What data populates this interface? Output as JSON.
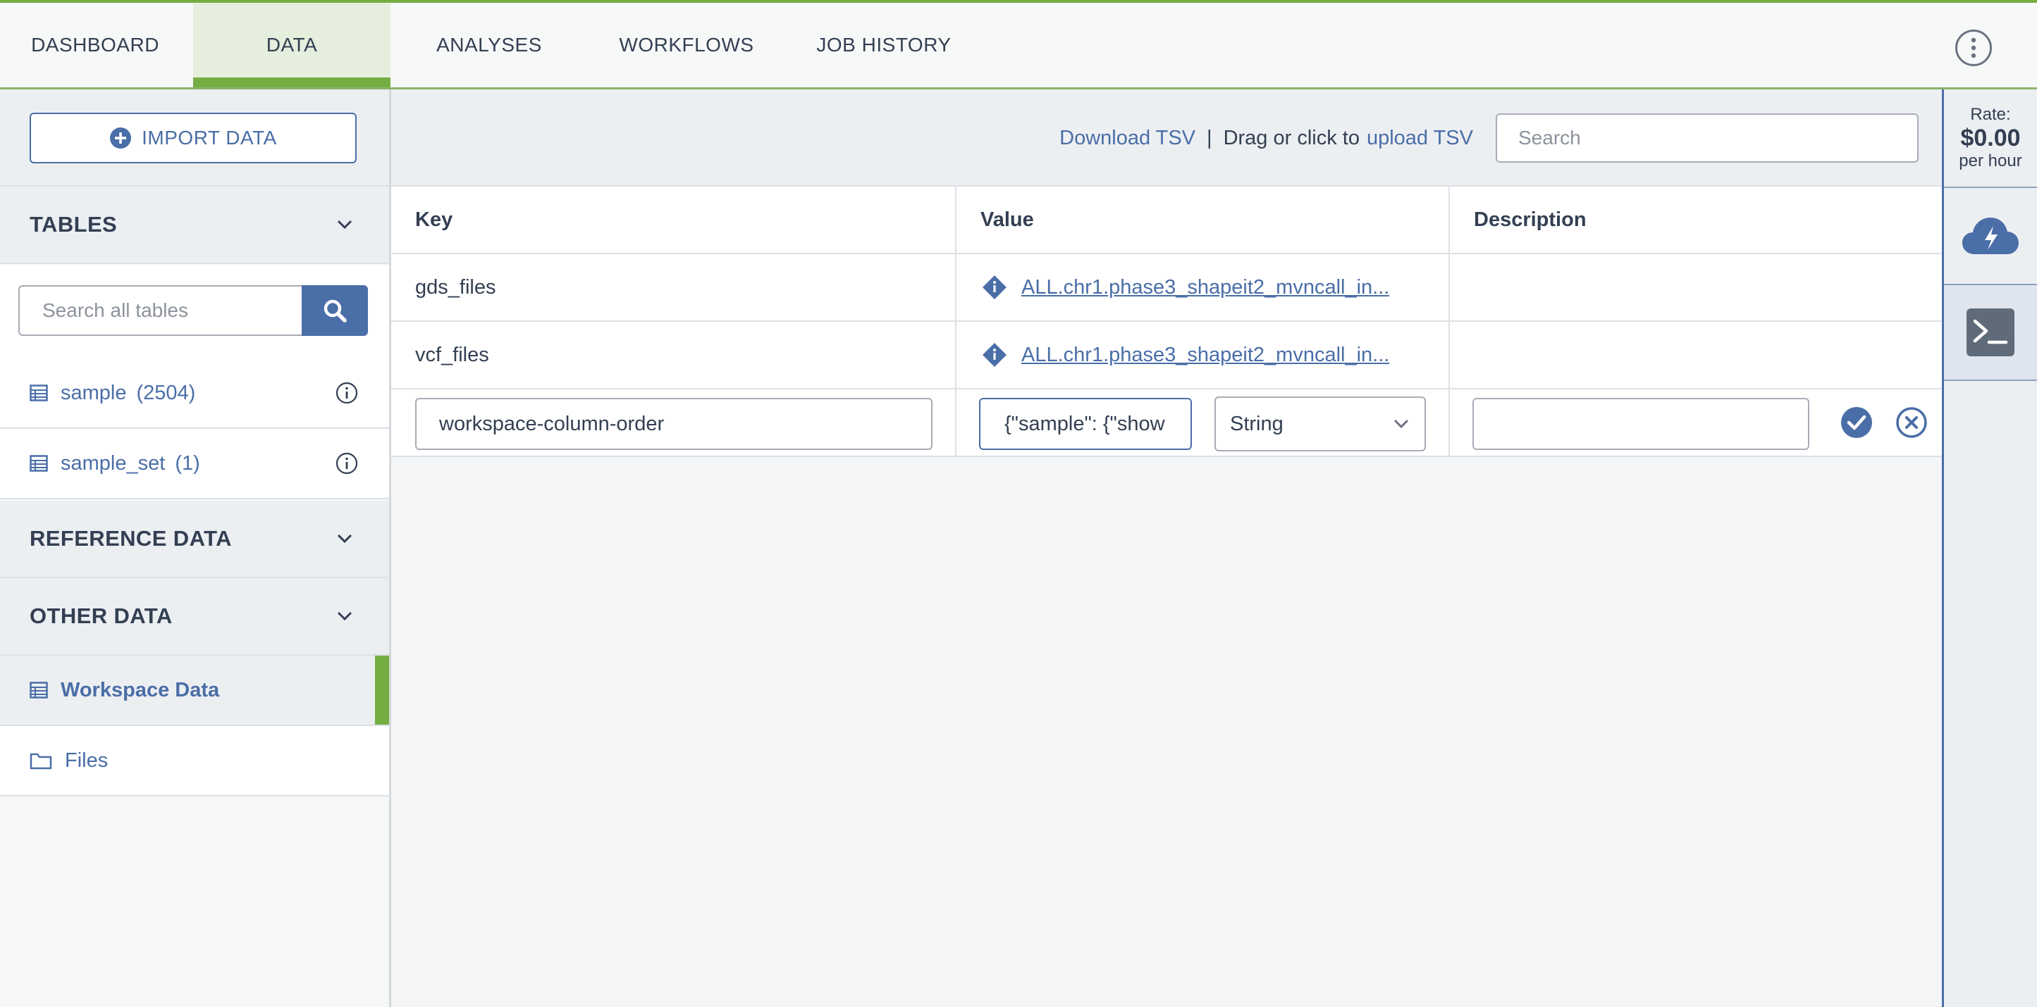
{
  "nav": {
    "tabs": [
      {
        "label": "DASHBOARD"
      },
      {
        "label": "DATA"
      },
      {
        "label": "ANALYSES"
      },
      {
        "label": "WORKFLOWS"
      },
      {
        "label": "JOB HISTORY"
      }
    ],
    "active_tab": "DATA",
    "menu_icon": "kebab-vertical-icon"
  },
  "sidebar": {
    "import_label": "IMPORT DATA",
    "tables_header": "TABLES",
    "search_placeholder": "Search all tables",
    "tables": [
      {
        "name": "sample",
        "count": "(2504)"
      },
      {
        "name": "sample_set",
        "count": "(1)"
      }
    ],
    "reference_header": "REFERENCE DATA",
    "other_header": "OTHER DATA",
    "other_items": [
      {
        "label": "Workspace Data",
        "icon": "table-icon",
        "selected": true
      },
      {
        "label": "Files",
        "icon": "folder-icon",
        "selected": false
      }
    ]
  },
  "toolbar": {
    "download_label": "Download TSV",
    "separator": "|",
    "drag_text": "Drag or click to",
    "upload_label": "upload TSV",
    "search_placeholder": "Search"
  },
  "grid": {
    "columns": [
      "Key",
      "Value",
      "Description"
    ],
    "rows": [
      {
        "key": "gds_files",
        "value": "ALL.chr1.phase3_shapeit2_mvncall_in...",
        "description": ""
      },
      {
        "key": "vcf_files",
        "value": "ALL.chr1.phase3_shapeit2_mvncall_in...",
        "description": ""
      }
    ],
    "edit_row": {
      "key_value": "workspace-column-order",
      "value_value": "{\"sample\": {\"show",
      "type_value": "String",
      "description_value": ""
    }
  },
  "rail": {
    "rate_label": "Rate:",
    "rate_value": "$0.00",
    "rate_unit": "per hour"
  },
  "colors": {
    "accent_green": "#74ae43",
    "link_blue": "#4a6ea7",
    "text_dark": "#333f52"
  }
}
